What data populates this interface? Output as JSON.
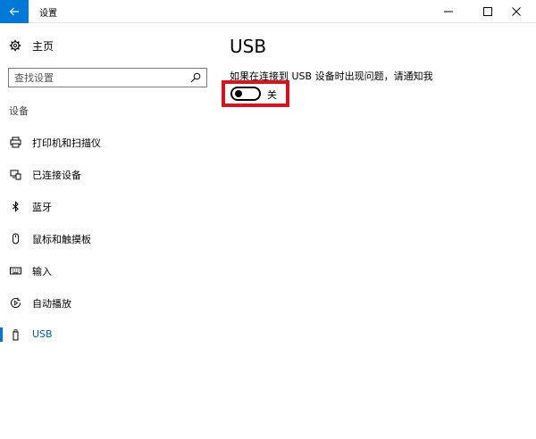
{
  "window": {
    "title": "设置"
  },
  "sidebar": {
    "home_label": "主页",
    "search_placeholder": "查找设置",
    "section_title": "设备",
    "items": [
      {
        "label": "打印机和扫描仪",
        "icon": "printer-icon"
      },
      {
        "label": "已连接设备",
        "icon": "connected-devices-icon"
      },
      {
        "label": "蓝牙",
        "icon": "bluetooth-icon"
      },
      {
        "label": "鼠标和触摸板",
        "icon": "mouse-icon"
      },
      {
        "label": "输入",
        "icon": "keyboard-icon"
      },
      {
        "label": "自动播放",
        "icon": "autoplay-icon"
      },
      {
        "label": "USB",
        "icon": "usb-icon",
        "selected": true
      }
    ]
  },
  "content": {
    "title": "USB",
    "description": "如果在连接到 USB 设备时出现问题，请通知我",
    "toggle_state_label": "关",
    "toggle_on": false
  },
  "colors": {
    "accent": "#0078d7",
    "highlight": "#d7141e"
  }
}
